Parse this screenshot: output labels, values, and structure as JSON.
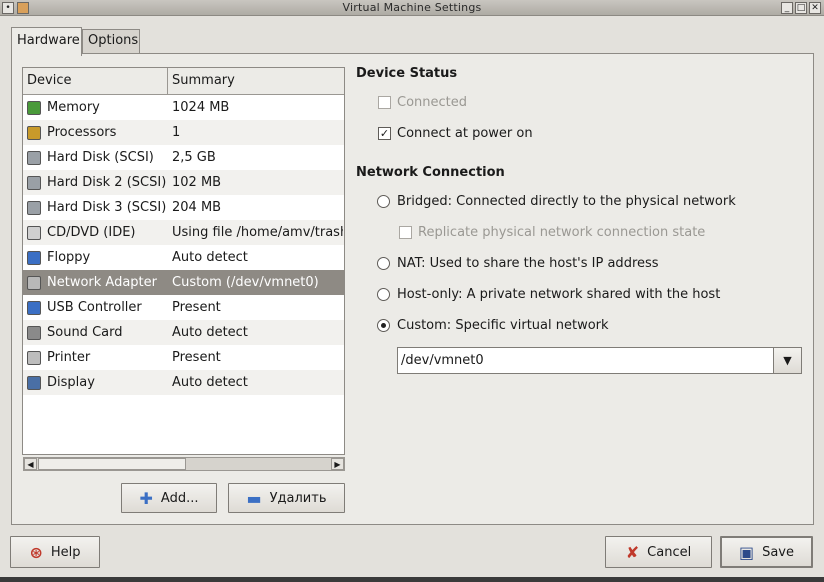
{
  "window": {
    "title": "Virtual Machine Settings"
  },
  "tabs": [
    {
      "label": "Hardware",
      "active": true
    },
    {
      "label": "Options",
      "active": false
    }
  ],
  "device_list": {
    "headers": {
      "device": "Device",
      "summary": "Summary"
    },
    "rows": [
      {
        "device": "Memory",
        "summary": "1024 MB",
        "icon": "memory-icon"
      },
      {
        "device": "Processors",
        "summary": "1",
        "icon": "processor-icon"
      },
      {
        "device": "Hard Disk (SCSI)",
        "summary": "2,5 GB",
        "icon": "hard-disk-icon"
      },
      {
        "device": "Hard Disk 2 (SCSI)",
        "summary": "102 MB",
        "icon": "hard-disk-icon"
      },
      {
        "device": "Hard Disk 3 (SCSI)",
        "summary": "204 MB",
        "icon": "hard-disk-icon"
      },
      {
        "device": "CD/DVD (IDE)",
        "summary": "Using file /home/amv/trash",
        "icon": "cd-icon"
      },
      {
        "device": "Floppy",
        "summary": "Auto detect",
        "icon": "floppy-icon"
      },
      {
        "device": "Network Adapter",
        "summary": "Custom (/dev/vmnet0)",
        "icon": "network-icon",
        "selected": true
      },
      {
        "device": "USB Controller",
        "summary": "Present",
        "icon": "usb-icon"
      },
      {
        "device": "Sound Card",
        "summary": "Auto detect",
        "icon": "sound-icon"
      },
      {
        "device": "Printer",
        "summary": "Present",
        "icon": "printer-icon"
      },
      {
        "device": "Display",
        "summary": "Auto detect",
        "icon": "display-icon"
      }
    ]
  },
  "buttons": {
    "add": "Add...",
    "remove": "Удалить",
    "help": "Help",
    "cancel": "Cancel",
    "save": "Save"
  },
  "device_status": {
    "title": "Device Status",
    "connected": {
      "label": "Connected",
      "checked": false,
      "enabled": false
    },
    "connect_at_power_on": {
      "label": "Connect at power on",
      "checked": true,
      "enabled": true
    }
  },
  "network_connection": {
    "title": "Network Connection",
    "bridged": {
      "label": "Bridged: Connected directly to the physical network",
      "selected": false
    },
    "replicate": {
      "label": "Replicate physical network connection state",
      "checked": false,
      "enabled": false
    },
    "nat": {
      "label": "NAT: Used to share the host's IP address",
      "selected": false
    },
    "host_only": {
      "label": "Host-only: A private network shared with the host",
      "selected": false
    },
    "custom": {
      "label": "Custom: Specific virtual network",
      "selected": true
    },
    "custom_network_value": "/dev/vmnet0"
  },
  "colors": {
    "selection": "#8e8a84",
    "background": "#e3e1dc"
  }
}
